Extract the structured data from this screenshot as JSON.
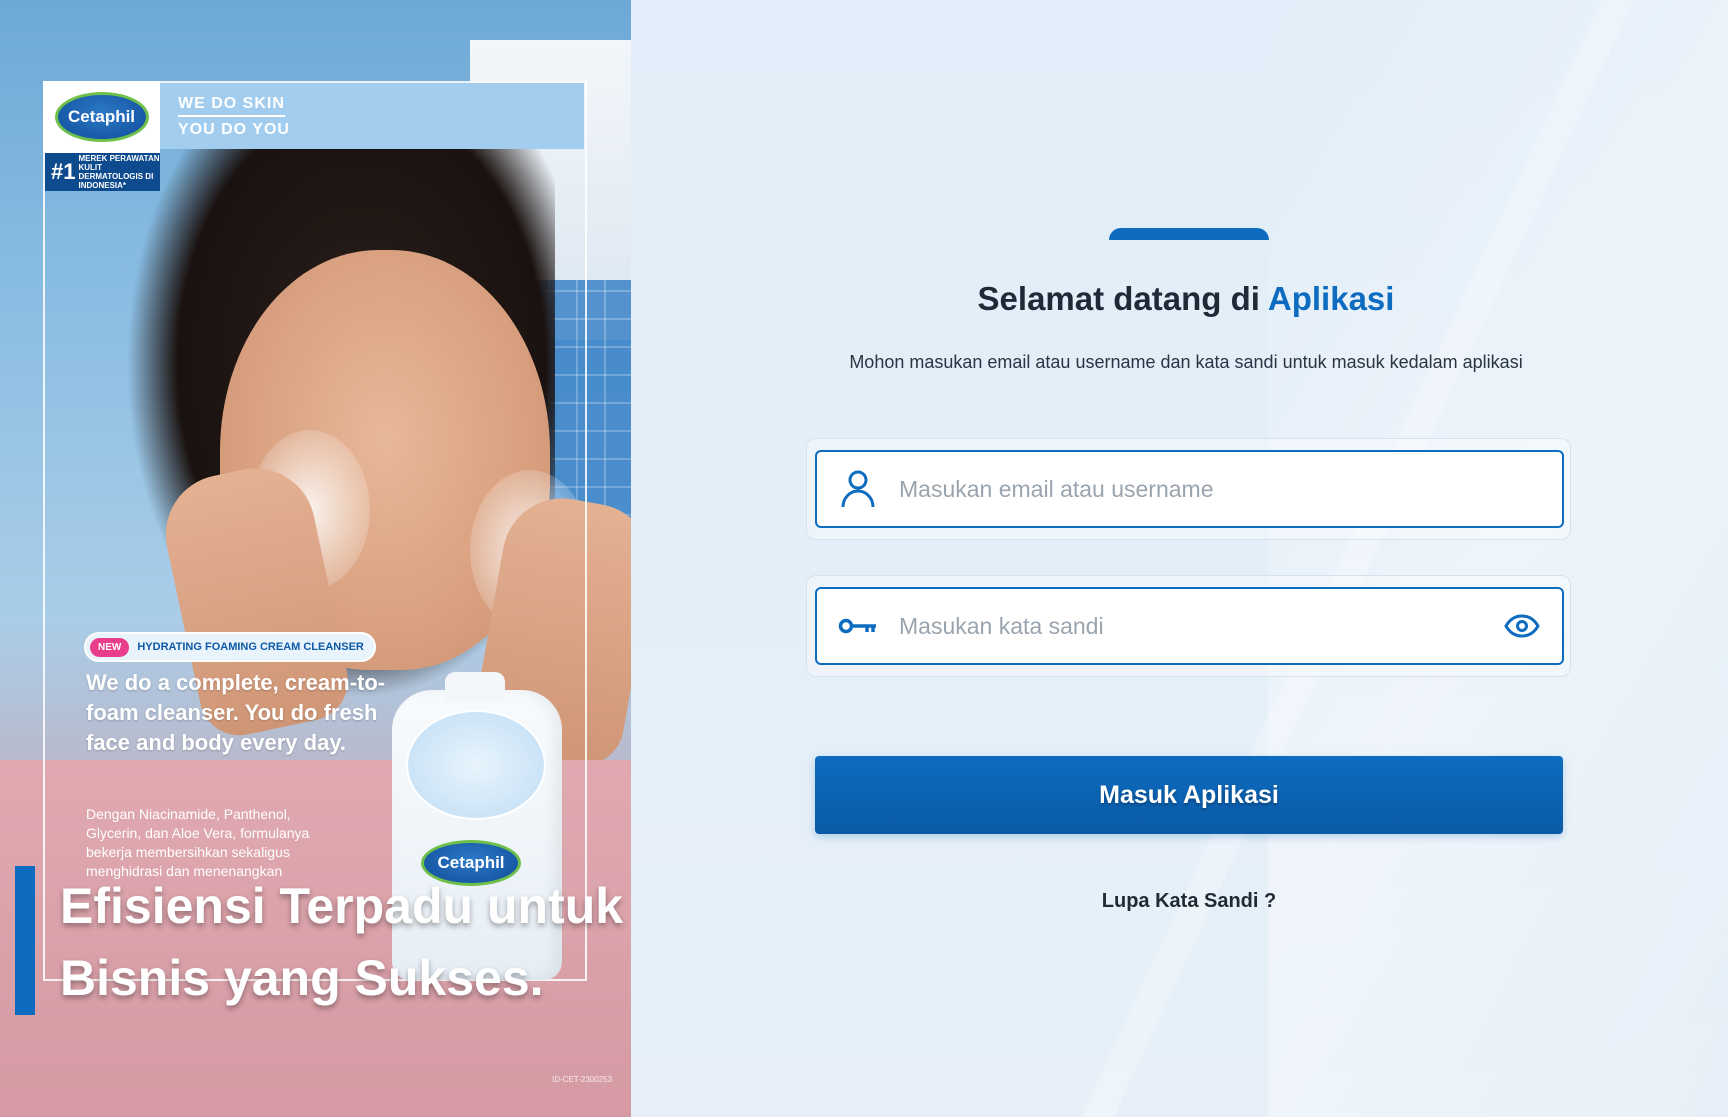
{
  "hero": {
    "brand_name": "Cetaphil",
    "tagline_line1": "WE DO SKIN",
    "tagline_line2": "YOU DO YOU",
    "rank_number": "#1",
    "rank_text": "MEREK PERAWATAN KULIT DERMATOLOGIS DI INDONESIA*",
    "product_badge": "NEW",
    "product_name": "HYDRATING FOAMING CREAM CLEANSER",
    "headline": "We do a complete, cream-to-foam cleanser. You do fresh face and body every day.",
    "body": "Dengan Niacinamide, Panthenol, Glycerin, dan Aloe Vera, formulanya bekerja membersihkan sekaligus menghidrasi dan menenangkan",
    "title_line1": "Efisiensi Terpadu untuk",
    "title_line2": "Bisnis yang Sukses.",
    "code": "ID-CET-2300253"
  },
  "login": {
    "title_prefix": "Selamat datang di",
    "title_accent": "Aplikasi",
    "subtitle": "Mohon masukan email atau username dan kata sandi untuk masuk kedalam aplikasi",
    "email_placeholder": "Masukan email atau username",
    "email_value": "",
    "password_placeholder": "Masukan kata sandi",
    "password_value": "",
    "submit_label": "Masuk Aplikasi",
    "forgot_label": "Lupa Kata Sandi ?",
    "icons": {
      "user": "user-icon",
      "key": "key-icon",
      "eye": "eye-icon"
    },
    "colors": {
      "accent": "#0d6cc0",
      "text": "#1f2a37",
      "background": "#e3eef8"
    }
  }
}
